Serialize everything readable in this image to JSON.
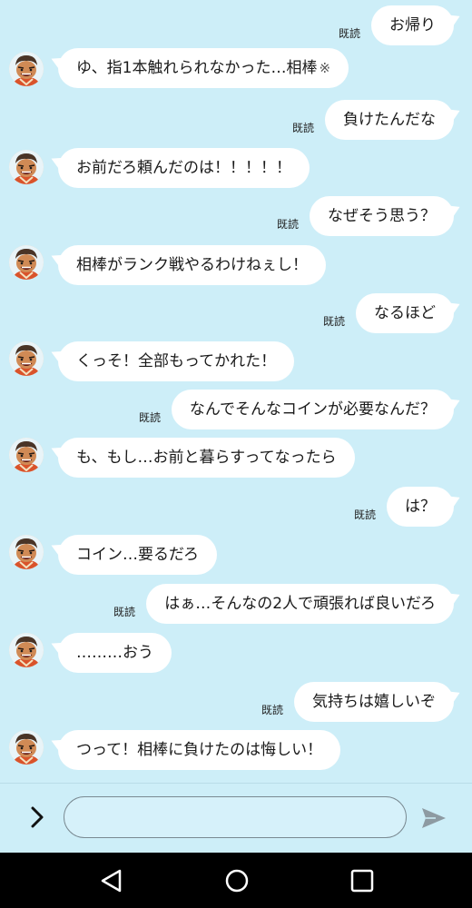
{
  "read_label": "既読",
  "messages": [
    {
      "side": "me",
      "text": "お帰り"
    },
    {
      "side": "them",
      "text": "ゆ、指1本触れられなかった…相棒",
      "mark": "※"
    },
    {
      "side": "me",
      "text": "負けたんだな"
    },
    {
      "side": "them",
      "text": "お前だろ頼んだのは！！！！！"
    },
    {
      "side": "me",
      "text": "なぜそう思う？"
    },
    {
      "side": "them",
      "text": "相棒がランク戦やるわけねぇし！"
    },
    {
      "side": "me",
      "text": "なるほど"
    },
    {
      "side": "them",
      "text": "くっそ！全部もってかれた！"
    },
    {
      "side": "me",
      "text": "なんでそんなコインが必要なんだ？"
    },
    {
      "side": "them",
      "text": "も、もし…お前と暮らすってなったら"
    },
    {
      "side": "me",
      "text": "は？"
    },
    {
      "side": "them",
      "text": "コイン…要るだろ"
    },
    {
      "side": "me",
      "text": "はぁ…そんなの2人で頑張れば良いだろ"
    },
    {
      "side": "them",
      "text": "………おう"
    },
    {
      "side": "me",
      "text": "気持ちは嬉しいぞ"
    },
    {
      "side": "them",
      "text": "つって！相棒に負けたのは悔しい！"
    }
  ],
  "composer": {
    "placeholder": "",
    "value": ""
  },
  "icons": {
    "expand": "chevron-right-icon",
    "send": "send-icon",
    "back": "nav-back-icon",
    "home": "nav-home-icon",
    "recents": "nav-recents-icon"
  },
  "colors": {
    "background": "#cdeef8",
    "bubble": "#ffffff",
    "navbar": "#000000"
  }
}
